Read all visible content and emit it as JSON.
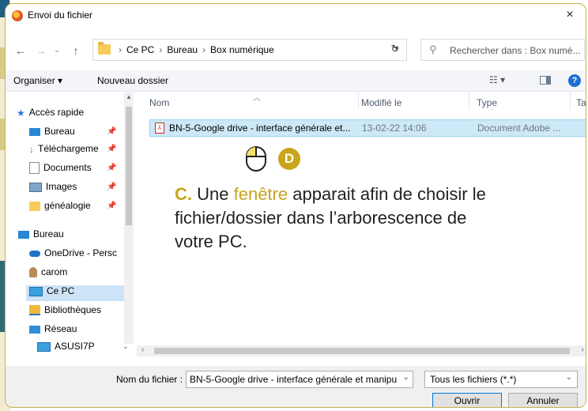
{
  "window": {
    "title": "Envoi du fichier",
    "close": "×"
  },
  "nav": {
    "back": "←",
    "forward": "→",
    "recent": "⌄",
    "up": "↑",
    "breadcrumb": [
      "Ce PC",
      "Bureau",
      "Box numérique"
    ],
    "refresh": "↻",
    "search_placeholder": "Rechercher dans : Box numé..."
  },
  "toolbar": {
    "organize": "Organiser ▾",
    "new_folder": "Nouveau dossier",
    "help": "?"
  },
  "sidebar": {
    "items": [
      {
        "label": "Accès rapide",
        "icon": "star-icon",
        "pinned": false
      },
      {
        "label": "Bureau",
        "icon": "desktop-icon",
        "pinned": true
      },
      {
        "label": "Téléchargeme",
        "icon": "download-icon",
        "pinned": true
      },
      {
        "label": "Documents",
        "icon": "document-icon",
        "pinned": true
      },
      {
        "label": "Images",
        "icon": "image-icon",
        "pinned": true
      },
      {
        "label": "généalogie",
        "icon": "folder-icon",
        "pinned": true
      },
      {
        "label": "Bureau",
        "icon": "desktop-icon",
        "pinned": false
      },
      {
        "label": "OneDrive - Persc",
        "icon": "cloud-icon",
        "pinned": false
      },
      {
        "label": "carom",
        "icon": "user-icon",
        "pinned": false
      },
      {
        "label": "Ce PC",
        "icon": "computer-icon",
        "pinned": false
      },
      {
        "label": "Bibliothèques",
        "icon": "library-icon",
        "pinned": false
      },
      {
        "label": "Réseau",
        "icon": "network-icon",
        "pinned": false
      },
      {
        "label": "ASUSI7P",
        "icon": "computer-icon",
        "pinned": false
      }
    ],
    "selected": "Ce PC"
  },
  "list": {
    "headers": {
      "name": "Nom",
      "modified": "Modifié le",
      "type": "Type",
      "size": "Tai"
    },
    "rows": [
      {
        "name": "BN-5-Google drive - interface générale et...",
        "modified": "13-02-22 14:06",
        "type": "Document Adobe ..."
      }
    ]
  },
  "bottom": {
    "filename_label": "Nom du fichier :",
    "filename_value": "BN-5-Google drive - interface générale et manipu",
    "filter": "Tous les fichiers (*.*)",
    "open": "Ouvrir",
    "cancel": "Annuler"
  },
  "overlay": {
    "step_badge": "D",
    "caption_letter": "C.",
    "caption_before": "Une",
    "caption_highlight": "fenêtre",
    "caption_after": "apparait afin de choisir le fichier/dossier dans l’arborescence de votre PC."
  },
  "colors": {
    "accent_gold": "#c9a41c",
    "selection_blue": "#cde8f7",
    "help_blue": "#1a6fd1"
  }
}
